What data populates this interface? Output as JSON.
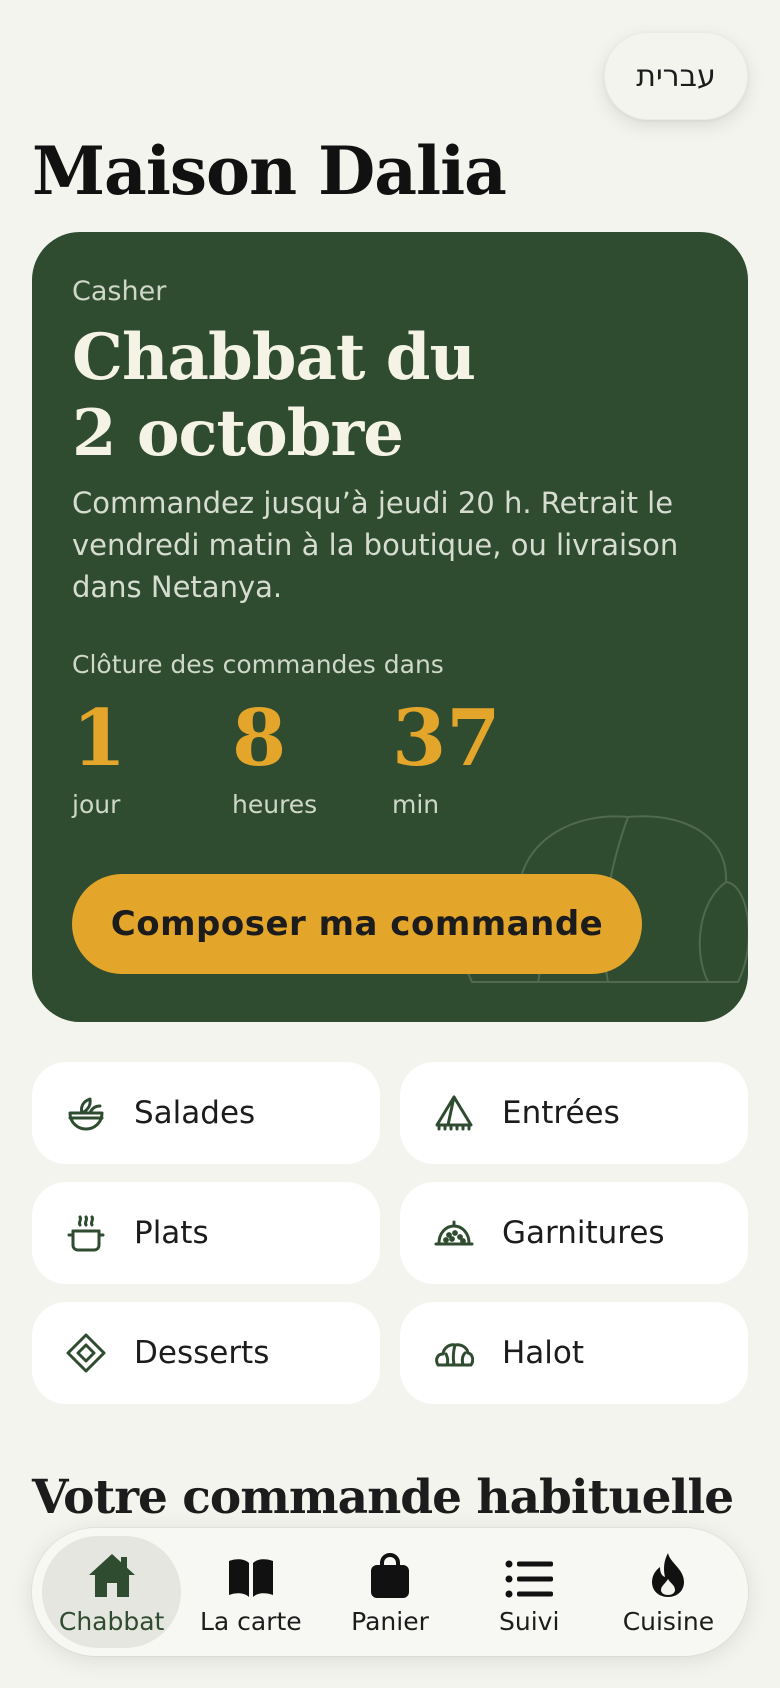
{
  "header": {
    "language_button": "עברית",
    "brand": "Maison Dalia"
  },
  "hero": {
    "eyebrow": "Casher",
    "title_line1": "Chabbat du",
    "title_line2": "2 octobre",
    "description": "Commandez jusqu’à jeudi 20 h. Retrait le vendredi matin à la boutique, ou livraison dans Netanya.",
    "countdown_label": "Clôture des commandes dans",
    "countdown": [
      {
        "value": "1",
        "unit": "jour"
      },
      {
        "value": "8",
        "unit": "heures"
      },
      {
        "value": "37",
        "unit": "min"
      }
    ],
    "cta_label": "Composer ma commande"
  },
  "categories": [
    {
      "label": "Salades",
      "icon": "salad-bowl-icon"
    },
    {
      "label": "Entrées",
      "icon": "pastry-triangle-icon"
    },
    {
      "label": "Plats",
      "icon": "pot-icon"
    },
    {
      "label": "Garnitures",
      "icon": "dish-cover-icon"
    },
    {
      "label": "Desserts",
      "icon": "diamond-icon"
    },
    {
      "label": "Halot",
      "icon": "challah-icon"
    }
  ],
  "section": {
    "title": "Votre commande habituelle"
  },
  "nav": {
    "items": [
      {
        "label": "Chabbat",
        "icon": "home-icon",
        "active": true
      },
      {
        "label": "La carte",
        "icon": "book-icon",
        "active": false
      },
      {
        "label": "Panier",
        "icon": "bag-icon",
        "active": false
      },
      {
        "label": "Suivi",
        "icon": "list-icon",
        "active": false
      },
      {
        "label": "Cuisine",
        "icon": "flame-icon",
        "active": false
      }
    ]
  },
  "colors": {
    "background": "#f4f4ef",
    "hero_green": "#2f4b30",
    "accent_gold": "#e3a52a",
    "icon_green": "#2f4b30"
  }
}
